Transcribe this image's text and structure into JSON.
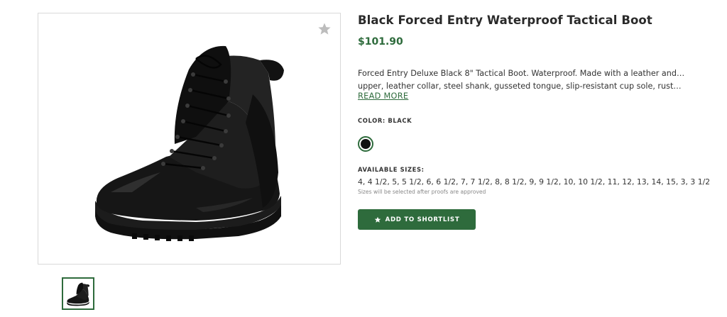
{
  "product": {
    "title": "Black Forced Entry Waterproof Tactical Boot",
    "price": "$101.90",
    "description_line1": "Forced Entry Deluxe Black 8\" Tactical Boot. Waterproof. Made with a leather and nylon",
    "description_line2": "upper, leather collar, steel shank, gusseted tongue, slip-resistant cup sole, rustproof eyelets.",
    "read_more": "READ MORE",
    "color_label": "COLOR: BLACK",
    "swatch_color": "#111111",
    "sizes_label": "AVAILABLE SIZES:",
    "sizes": "4, 4 1/2, 5, 5 1/2, 6, 6 1/2, 7, 7 1/2, 8, 8 1/2, 9, 9 1/2, 10, 10 1/2, 11, 12, 13, 14, 15, 3, 3 1/2",
    "sizes_note": "Sizes will be selected after proofs are approved",
    "add_button": "ADD TO SHORTLIST"
  },
  "icons": {
    "favorite": "star-icon",
    "add": "star-icon"
  },
  "colors": {
    "accent": "#2e6b3c",
    "favorite_star": "#bdbdbd"
  }
}
